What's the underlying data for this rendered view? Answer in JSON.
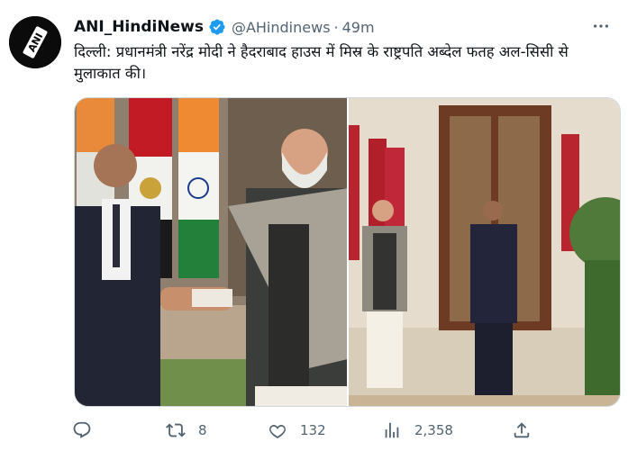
{
  "account": {
    "display_name": "ANI_HindiNews",
    "handle": "@AHindinews",
    "separator": "·",
    "timestamp": "49m",
    "verified": true,
    "avatar_icon": "ani-logo-icon"
  },
  "tweet": {
    "text": "दिल्ली: प्रधानमंत्री नरेंद्र मोदी ने हैदराबाद हाउस में मिस्र के राष्ट्रपति अब्देल फतह अल-सिसी से मुलाकात की।"
  },
  "media": {
    "photo_count": 2
  },
  "actions": {
    "reply": {
      "icon": "reply-icon",
      "count": ""
    },
    "retweet": {
      "icon": "retweet-icon",
      "count": "8"
    },
    "like": {
      "icon": "heart-icon",
      "count": "132"
    },
    "views": {
      "icon": "views-icon",
      "count": "2,358"
    },
    "share": {
      "icon": "share-icon",
      "count": ""
    }
  },
  "colors": {
    "verified": "#1d9bf0",
    "secondary_text": "#536471",
    "primary_text": "#0f1419"
  }
}
